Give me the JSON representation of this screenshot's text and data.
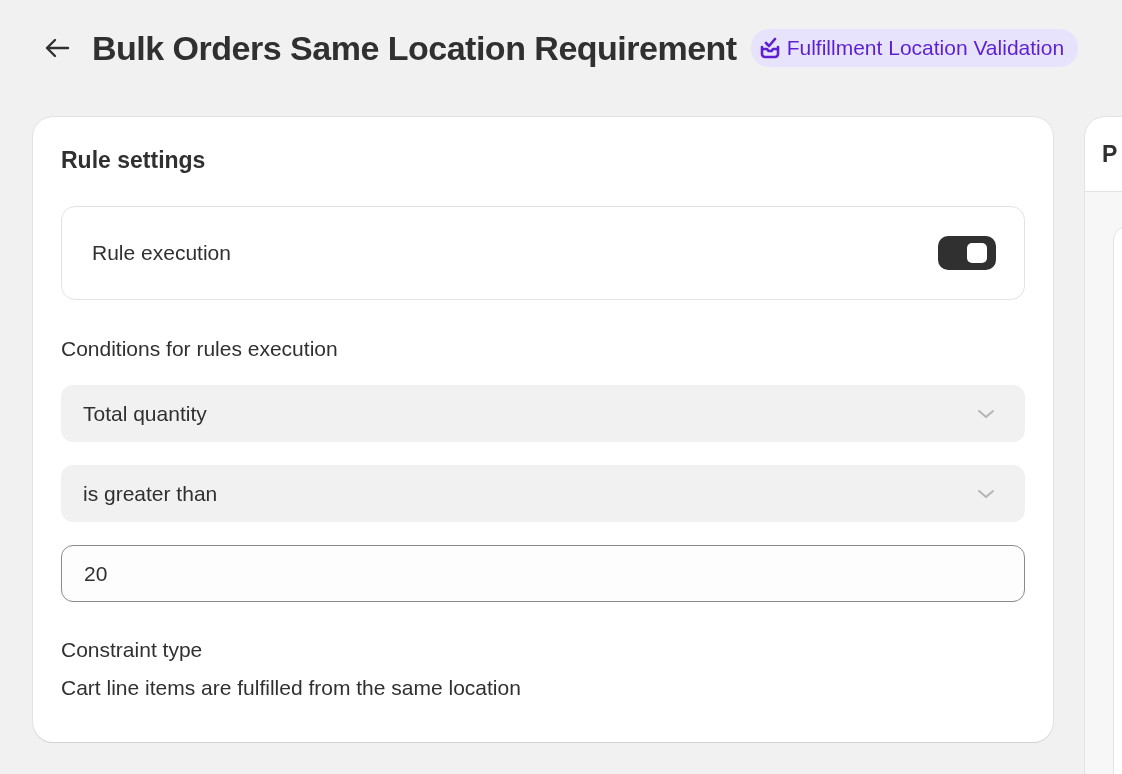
{
  "header": {
    "title": "Bulk Orders Same Location Requirement",
    "badge": "Fulfillment Location Validation"
  },
  "rule_settings": {
    "title": "Rule settings",
    "rule_execution": {
      "label": "Rule execution",
      "on": true
    },
    "conditions_label": "Conditions for rules execution",
    "selects": [
      {
        "value": "Total quantity"
      },
      {
        "value": "is greater than"
      }
    ],
    "amount_field": {
      "value": "20"
    },
    "constraint_label": "Constraint type",
    "constraint_value": "Cart line items are fulfilled from the same location"
  },
  "side_panel": {
    "title": "P"
  }
}
